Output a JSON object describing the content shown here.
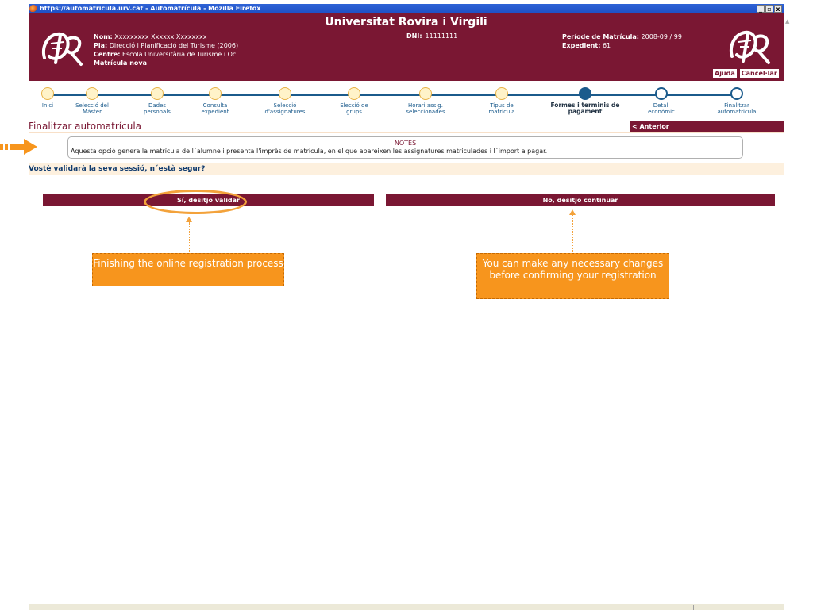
{
  "window": {
    "title": "https://automatricula.urv.cat - Automatrícula - Mozilla Firefox",
    "controls": [
      "_",
      "▫",
      "x"
    ]
  },
  "header": {
    "university": "Universitat Rovira i Virgili",
    "student": {
      "name_label": "Nom:",
      "name_value": "Xxxxxxxxx Xxxxxx Xxxxxxxx",
      "plan_label": "Pla:",
      "plan_value": "Direcció i Planificació del Turisme (2006)",
      "centre_label": "Centre:",
      "centre_value": "Escola Universitària de Turisme i Oci",
      "enrollment_type": "Matrícula nova"
    },
    "dni_label": "DNI:",
    "dni_value": "11111111",
    "period_label": "Període de Matrícula:",
    "period_value": "2008-09 / 99",
    "record_label": "Expedient:",
    "record_value": "61",
    "help_button": "Ajuda",
    "cancel_button": "Cancel·lar"
  },
  "steps": [
    {
      "line1": "Inici",
      "line2": "",
      "state": "done"
    },
    {
      "line1": "Selecció del",
      "line2": "Màster",
      "state": "done"
    },
    {
      "line1": "Dades",
      "line2": "personals",
      "state": "done"
    },
    {
      "line1": "Consulta",
      "line2": "expedient",
      "state": "done"
    },
    {
      "line1": "Selecció",
      "line2": "d'assignatures",
      "state": "done"
    },
    {
      "line1": "Elecció de",
      "line2": "grups",
      "state": "done"
    },
    {
      "line1": "Horari assig.",
      "line2": "seleccionades",
      "state": "done"
    },
    {
      "line1": "Tipus de",
      "line2": "matrícula",
      "state": "done"
    },
    {
      "line1": "Formes i terminis de",
      "line2": "pagament",
      "state": "current"
    },
    {
      "line1": "Detall",
      "line2": "econòmic",
      "state": "future"
    },
    {
      "line1": "Finalitzar",
      "line2": "automatrícula",
      "state": "future"
    }
  ],
  "section": {
    "title": "Finalitzar automatrícula",
    "previous_button": "< Anterior"
  },
  "notes": {
    "title": "NOTES",
    "body": "Aquesta opció genera la matrícula de l´alumne i presenta l'imprès de matrícula, en el que apareixen les assignatures matriculades i l´import a pagar."
  },
  "question": "Vostè validarà la seva sessió, n´està segur?",
  "actions": {
    "yes": "Sí, desitjo validar",
    "no": "No, desitjo continuar"
  },
  "callouts": {
    "yes": "Finishing the online registration process",
    "no": "You can make any necessary changes before confirming your registration"
  },
  "colors": {
    "brand": "#7a1733",
    "step_blue": "#1b5b8c",
    "callout_orange": "#f7951d"
  }
}
